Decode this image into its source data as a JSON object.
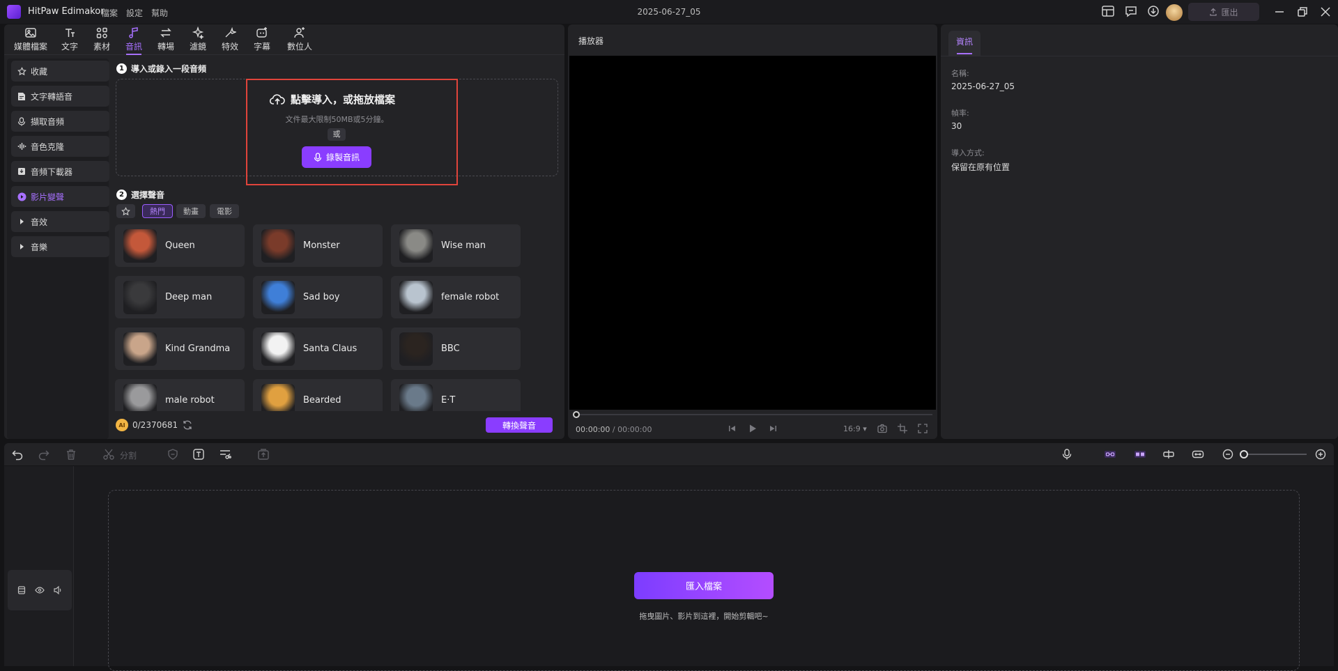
{
  "app": {
    "name": "HitPaw Edimakor",
    "doc_title": "2025-06-27_05"
  },
  "menu": [
    "檔案",
    "設定",
    "幫助"
  ],
  "titlebar": {
    "export_label": "匯出"
  },
  "tabs": [
    {
      "label": "媒體檔案",
      "icon": "image-icon"
    },
    {
      "label": "文字",
      "icon": "text-icon"
    },
    {
      "label": "素材",
      "icon": "grid-icon"
    },
    {
      "label": "音訊",
      "icon": "music-icon",
      "active": true
    },
    {
      "label": "轉場",
      "icon": "transition-icon"
    },
    {
      "label": "濾鏡",
      "icon": "sparkle-icon"
    },
    {
      "label": "特效",
      "icon": "effects-icon"
    },
    {
      "label": "字幕",
      "icon": "subtitle-icon"
    },
    {
      "label": "數位人",
      "icon": "avatar-icon"
    }
  ],
  "sidebar": [
    {
      "label": "收藏",
      "icon": "star-icon"
    },
    {
      "label": "文字轉語音",
      "icon": "tts-icon"
    },
    {
      "label": "擷取音頻",
      "icon": "extract-audio-icon"
    },
    {
      "label": "音色克隆",
      "icon": "waveform-icon"
    },
    {
      "label": "音頻下載器",
      "icon": "download-icon"
    },
    {
      "label": "影片變聲",
      "icon": "voice-change-icon",
      "active": true
    },
    {
      "label": "音效",
      "icon": "caret-right-icon"
    },
    {
      "label": "音樂",
      "icon": "caret-right-icon"
    }
  ],
  "import_section": {
    "step1_num": "1",
    "step1_title": "導入或錄入一段音頻",
    "drop_title": "點擊導入，或拖放檔案",
    "drop_hint": "文件最大限制50MB或5分鐘。",
    "or_label": "或",
    "record_label": "錄製音訊"
  },
  "voice_section": {
    "step2_num": "2",
    "step2_title": "選擇聲音",
    "filters": [
      {
        "label": "熱門",
        "active": true
      },
      {
        "label": "動畫"
      },
      {
        "label": "電影"
      }
    ],
    "voices": [
      {
        "name": "Queen",
        "color": "#c4583a"
      },
      {
        "name": "Monster",
        "color": "#7a3b2a"
      },
      {
        "name": "Wise man",
        "color": "#8a8a86"
      },
      {
        "name": "Deep man",
        "color": "#3a3a3c"
      },
      {
        "name": "Sad boy",
        "color": "#3f7fd8"
      },
      {
        "name": "female robot",
        "color": "#b9c4cf"
      },
      {
        "name": "Kind Grandma",
        "color": "#c9a58a"
      },
      {
        "name": "Santa Claus",
        "color": "#f2f2f2"
      },
      {
        "name": "BBC",
        "color": "#2b2420"
      },
      {
        "name": "male robot",
        "color": "#9a9a9c"
      },
      {
        "name": "Bearded",
        "color": "#e0a040"
      },
      {
        "name": "E·T",
        "color": "#6a7a8a"
      }
    ]
  },
  "credits": {
    "badge": "AI",
    "value": "0/2370681"
  },
  "convert_label": "轉換聲音",
  "player": {
    "title": "播放器",
    "time_current": "00:00:00",
    "time_total": "/ 00:00:00",
    "aspect": "16:9"
  },
  "info": {
    "tab": "資訊",
    "name_label": "名稱:",
    "name_value": "2025-06-27_05",
    "fps_label": "幀率:",
    "fps_value": "30",
    "import_label": "導入方式:",
    "import_value": "保留在原有位置"
  },
  "timeline": {
    "split_label": "分割",
    "import_label": "匯入檔案",
    "hint": "拖曳圖片、影片到這裡，開始剪輯吧~"
  },
  "colors": {
    "accent": "#8a3dff",
    "highlight": "#e0443b"
  }
}
